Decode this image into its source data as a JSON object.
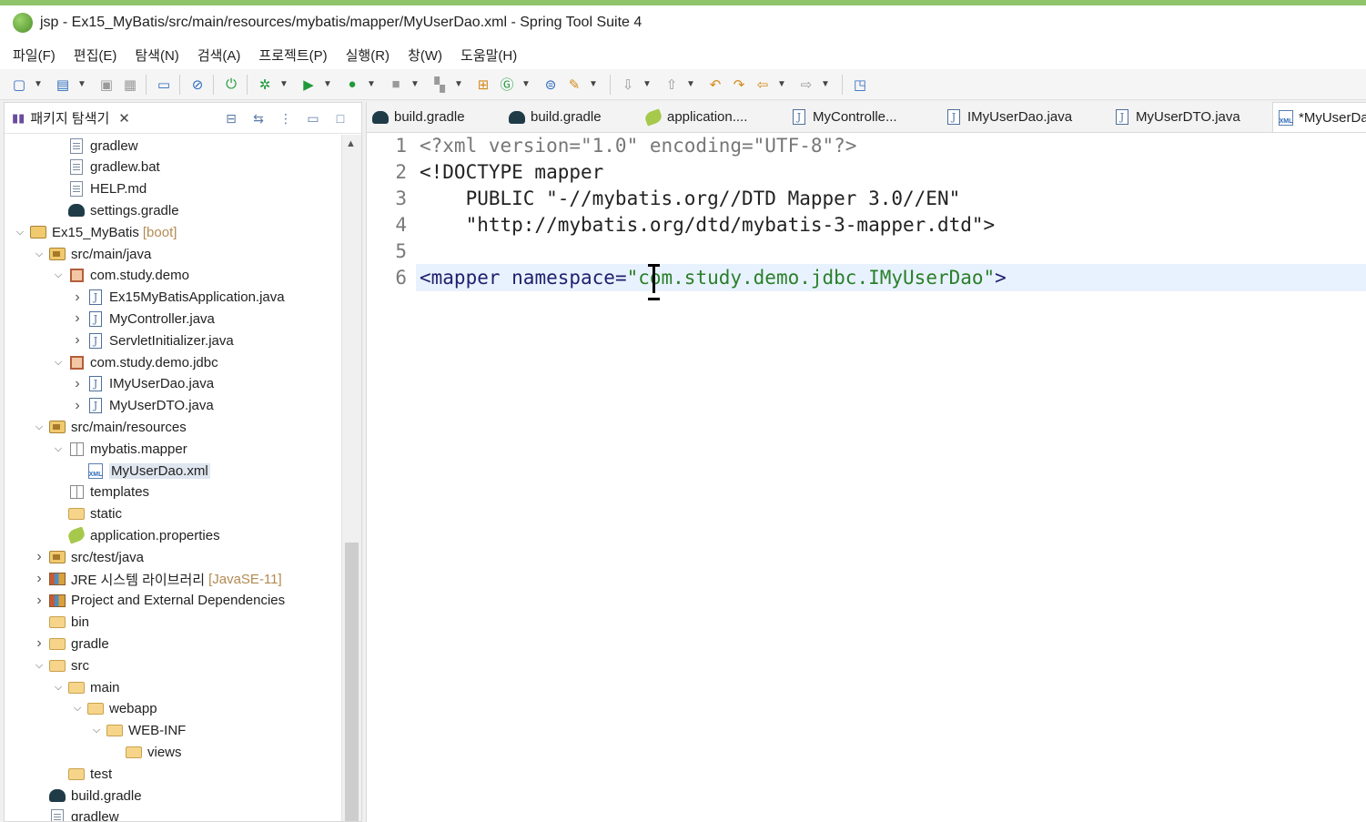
{
  "window": {
    "title": "jsp - Ex15_MyBatis/src/main/resources/mybatis/mapper/MyUserDao.xml - Spring Tool Suite 4"
  },
  "menu": [
    "파일(F)",
    "편집(E)",
    "탐색(N)",
    "검색(A)",
    "프로젝트(P)",
    "실행(R)",
    "창(W)",
    "도움말(H)"
  ],
  "explorer": {
    "title": "패키지 탐색기",
    "close": "✕"
  },
  "tree": [
    {
      "label": "gradlew",
      "indent": 2,
      "twisty": "",
      "icon": "file"
    },
    {
      "label": "gradlew.bat",
      "indent": 2,
      "twisty": "",
      "icon": "file"
    },
    {
      "label": "HELP.md",
      "indent": 2,
      "twisty": "",
      "icon": "file"
    },
    {
      "label": "settings.gradle",
      "indent": 2,
      "twisty": "",
      "icon": "gradle"
    },
    {
      "label": "Ex15_MyBatis",
      "indent": 0,
      "twisty": "v",
      "icon": "project",
      "deco": "[boot]"
    },
    {
      "label": "src/main/java",
      "indent": 1,
      "twisty": "v",
      "icon": "srcfolder"
    },
    {
      "label": "com.study.demo",
      "indent": 2,
      "twisty": "v",
      "icon": "package"
    },
    {
      "label": "Ex15MyBatisApplication.java",
      "indent": 3,
      "twisty": ">",
      "icon": "java"
    },
    {
      "label": "MyController.java",
      "indent": 3,
      "twisty": ">",
      "icon": "java"
    },
    {
      "label": "ServletInitializer.java",
      "indent": 3,
      "twisty": ">",
      "icon": "java"
    },
    {
      "label": "com.study.demo.jdbc",
      "indent": 2,
      "twisty": "v",
      "icon": "package"
    },
    {
      "label": "IMyUserDao.java",
      "indent": 3,
      "twisty": ">",
      "icon": "java-interface"
    },
    {
      "label": "MyUserDTO.java",
      "indent": 3,
      "twisty": ">",
      "icon": "java"
    },
    {
      "label": "src/main/resources",
      "indent": 1,
      "twisty": "v",
      "icon": "srcfolder"
    },
    {
      "label": "mybatis.mapper",
      "indent": 2,
      "twisty": "v",
      "icon": "package-empty"
    },
    {
      "label": "MyUserDao.xml",
      "indent": 3,
      "twisty": "",
      "icon": "xml",
      "selected": true
    },
    {
      "label": "templates",
      "indent": 2,
      "twisty": "",
      "icon": "package-empty"
    },
    {
      "label": "static",
      "indent": 2,
      "twisty": "",
      "icon": "folder"
    },
    {
      "label": "application.properties",
      "indent": 2,
      "twisty": "",
      "icon": "properties"
    },
    {
      "label": "src/test/java",
      "indent": 1,
      "twisty": ">",
      "icon": "srcfolder"
    },
    {
      "label": "JRE 시스템 라이브러리",
      "indent": 1,
      "twisty": ">",
      "icon": "library",
      "deco": "[JavaSE-11]"
    },
    {
      "label": "Project and External Dependencies",
      "indent": 1,
      "twisty": ">",
      "icon": "library"
    },
    {
      "label": "bin",
      "indent": 1,
      "twisty": "",
      "icon": "folder"
    },
    {
      "label": "gradle",
      "indent": 1,
      "twisty": ">",
      "icon": "folder"
    },
    {
      "label": "src",
      "indent": 1,
      "twisty": "v",
      "icon": "folder"
    },
    {
      "label": "main",
      "indent": 2,
      "twisty": "v",
      "icon": "folder"
    },
    {
      "label": "webapp",
      "indent": 3,
      "twisty": "v",
      "icon": "folder"
    },
    {
      "label": "WEB-INF",
      "indent": 4,
      "twisty": "v",
      "icon": "folder"
    },
    {
      "label": "views",
      "indent": 5,
      "twisty": "",
      "icon": "folder"
    },
    {
      "label": "test",
      "indent": 2,
      "twisty": "",
      "icon": "folder"
    },
    {
      "label": "build.gradle",
      "indent": 1,
      "twisty": "",
      "icon": "gradle"
    },
    {
      "label": "gradlew",
      "indent": 1,
      "twisty": "",
      "icon": "file"
    }
  ],
  "tabs": [
    {
      "label": "build.gradle",
      "icon": "gradle"
    },
    {
      "label": "build.gradle",
      "icon": "gradle"
    },
    {
      "label": "application....",
      "icon": "properties"
    },
    {
      "label": "MyControlle...",
      "icon": "java"
    },
    {
      "label": "IMyUserDao.java",
      "icon": "java"
    },
    {
      "label": "MyUserDTO.java",
      "icon": "java"
    },
    {
      "label": "*MyUserDa",
      "icon": "xml",
      "active": true
    }
  ],
  "code": {
    "line_numbers": [
      "1",
      "2",
      "3",
      "4",
      "5",
      "6"
    ],
    "l1": "<?xml version=\"1.0\" encoding=\"UTF-8\"?>",
    "l2": "<!DOCTYPE mapper",
    "l3": "    PUBLIC \"-//mybatis.org//DTD Mapper 3.0//EN\"",
    "l4": "    \"http://mybatis.org/dtd/mybatis-3-mapper.dtd\">",
    "l5": "",
    "l6_tag": "<mapper ",
    "l6_attr": "namespace=",
    "l6_str": "\"com.study.demo.jdbc.IMyUserDao\"",
    "l6_end": ">"
  }
}
